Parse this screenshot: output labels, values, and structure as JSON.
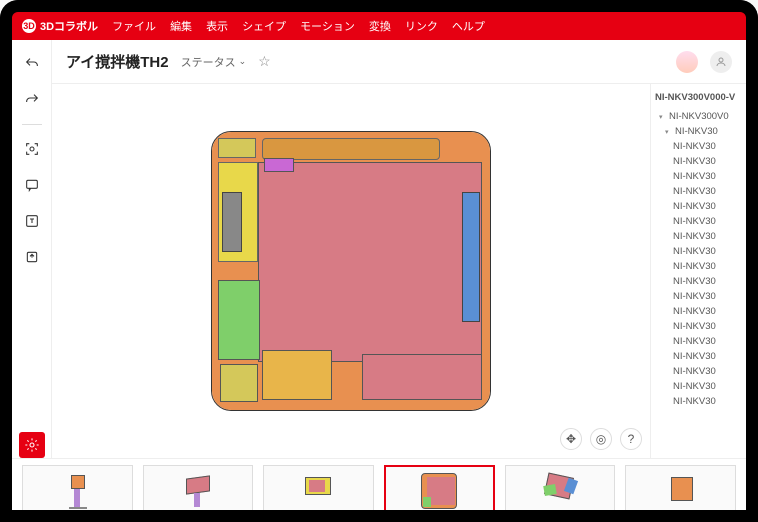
{
  "app": {
    "name": "3Dコラボル"
  },
  "menu": {
    "file": "ファイル",
    "edit": "編集",
    "view": "表示",
    "shape": "シェイプ",
    "motion": "モーション",
    "transform": "変換",
    "link": "リンク",
    "help": "ヘルプ"
  },
  "doc": {
    "title": "アイ撹拌機TH2",
    "status_label": "ステータス"
  },
  "tree": {
    "root": "NI-NKV300V000-V",
    "items": [
      {
        "label": "NI-NKV300V0",
        "level": 1,
        "expand": true
      },
      {
        "label": "NI-NKV30",
        "level": 2,
        "expand": true
      },
      {
        "label": "NI-NKV30",
        "level": 3
      },
      {
        "label": "NI-NKV30",
        "level": 3
      },
      {
        "label": "NI-NKV30",
        "level": 3
      },
      {
        "label": "NI-NKV30",
        "level": 3
      },
      {
        "label": "NI-NKV30",
        "level": 3
      },
      {
        "label": "NI-NKV30",
        "level": 3
      },
      {
        "label": "NI-NKV30",
        "level": 3
      },
      {
        "label": "NI-NKV30",
        "level": 3
      },
      {
        "label": "NI-NKV30",
        "level": 3
      },
      {
        "label": "NI-NKV30",
        "level": 3
      },
      {
        "label": "NI-NKV30",
        "level": 3
      },
      {
        "label": "NI-NKV30",
        "level": 3
      },
      {
        "label": "NI-NKV30",
        "level": 3
      },
      {
        "label": "NI-NKV30",
        "level": 3
      },
      {
        "label": "NI-NKV30",
        "level": 3
      },
      {
        "label": "NI-NKV30",
        "level": 3
      },
      {
        "label": "NI-NKV30",
        "level": 3
      },
      {
        "label": "NI-NKV30",
        "level": 3
      }
    ]
  },
  "thumbnails": [
    {
      "selected": false
    },
    {
      "selected": false
    },
    {
      "selected": false
    },
    {
      "selected": true
    },
    {
      "selected": false
    },
    {
      "selected": false
    }
  ],
  "icons": {
    "star": "☆",
    "chevron": "⌄",
    "help": "?",
    "move": "✥",
    "target": "◎",
    "plus": "+"
  }
}
